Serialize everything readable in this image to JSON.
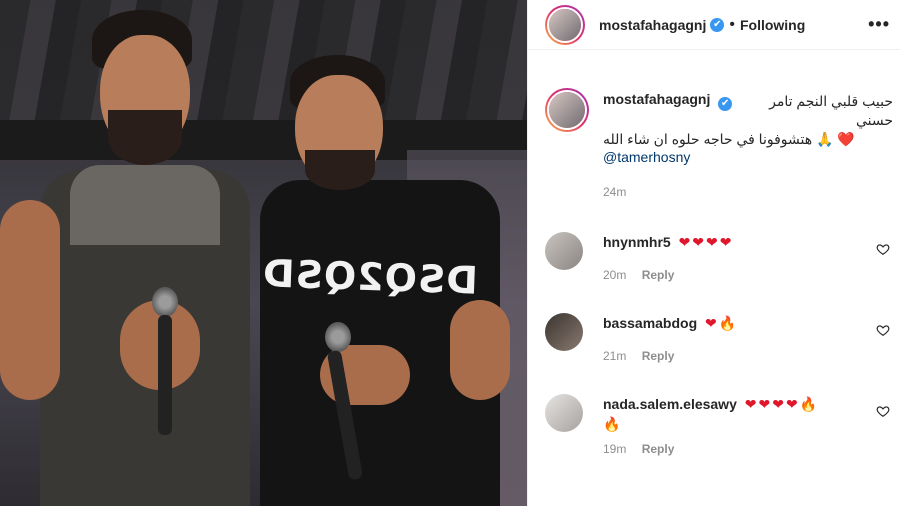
{
  "header": {
    "username": "mostafahagagnj",
    "verified_badge": "✔",
    "separator": "•",
    "follow_status": "Following",
    "more_icon": "•••"
  },
  "photo": {
    "shirt_print": "DSQ2QSD"
  },
  "caption": {
    "username": "mostafahagagnj",
    "line1": "حبيب قلبي النجم تامر حسني",
    "line2": "❤️ 🙏 هتشوفونا في حاجه حلوه ان شاء الله",
    "mention": "@tamerhosny",
    "time": "24m"
  },
  "comments": [
    {
      "username": "hnynmhr5",
      "text": "❤❤❤❤",
      "time": "20m",
      "reply": "Reply"
    },
    {
      "username": "bassamabdog",
      "text": "❤🔥",
      "time": "21m",
      "reply": "Reply"
    },
    {
      "username": "nada.salem.elesawy",
      "text": "❤❤❤❤🔥",
      "text2": "🔥",
      "time": "19m",
      "reply": "Reply"
    }
  ],
  "colors": {
    "link": "#00376b",
    "muted": "#8e8e8e",
    "verified": "#3897f0",
    "heart": "#e0162b"
  }
}
